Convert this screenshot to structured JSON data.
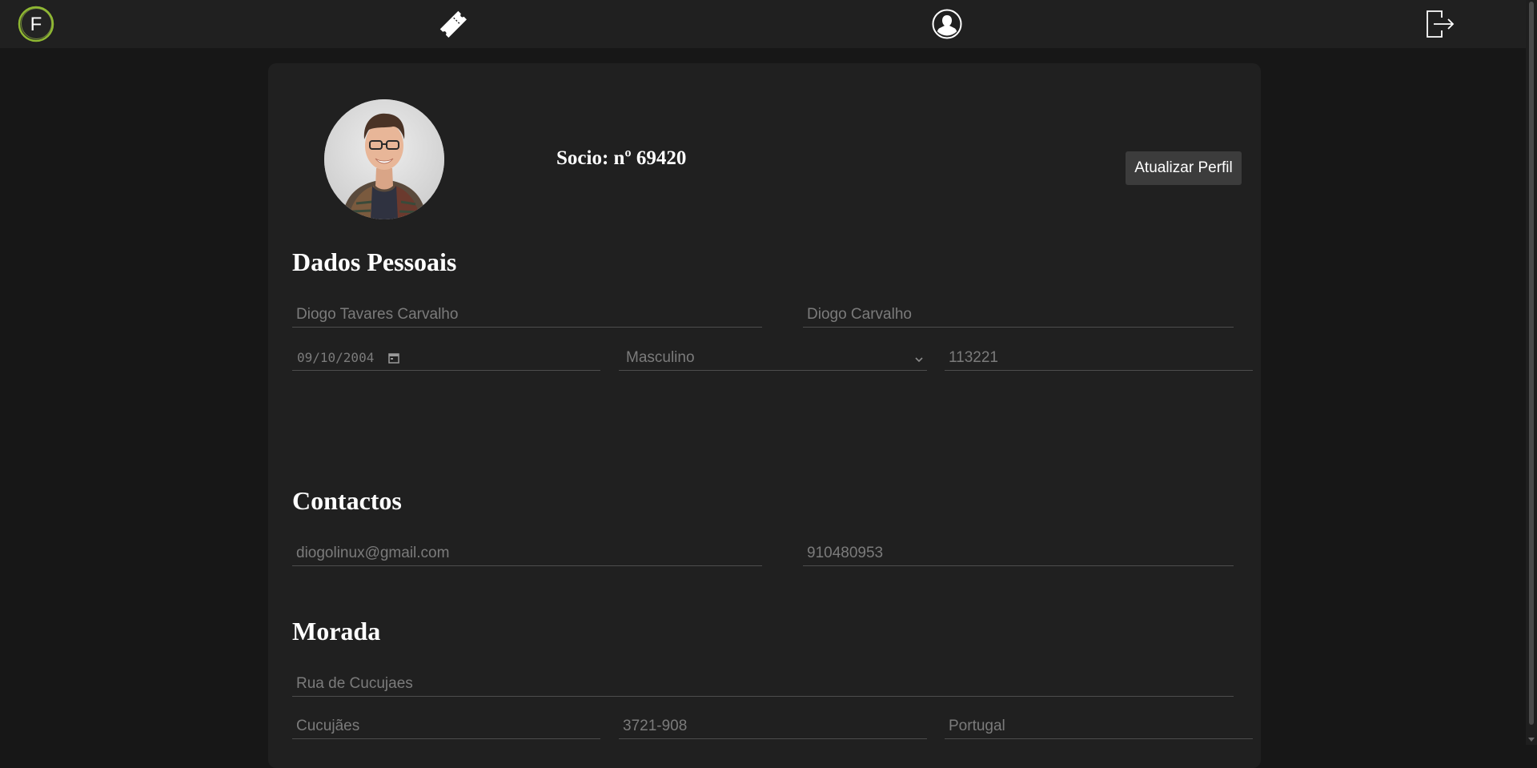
{
  "nav": {
    "logo_letter": "F",
    "accent_color": "#8fb832",
    "items": [
      {
        "name": "tickets",
        "icon": "ticket-icon"
      },
      {
        "name": "profile",
        "icon": "user-profile-icon"
      },
      {
        "name": "logout",
        "icon": "logout-icon"
      }
    ]
  },
  "profile": {
    "avatar_icon": "avatar-photo",
    "socio_label": "Socio: nº 69420",
    "update_button": "Atualizar Perfil"
  },
  "sections": {
    "personal": {
      "title": "Dados Pessoais",
      "full_name": "Diogo Tavares Carvalho",
      "short_name": "Diogo Carvalho",
      "birth_date": "09/10/2004",
      "gender": "Masculino",
      "id_number": "113221"
    },
    "contacts": {
      "title": "Contactos",
      "email": "diogolinux@gmail.com",
      "phone": "910480953"
    },
    "address": {
      "title": "Morada",
      "street": "Rua de Cucujaes",
      "city": "Cucujães",
      "postal_code": "3721-908",
      "country": "Portugal"
    }
  }
}
